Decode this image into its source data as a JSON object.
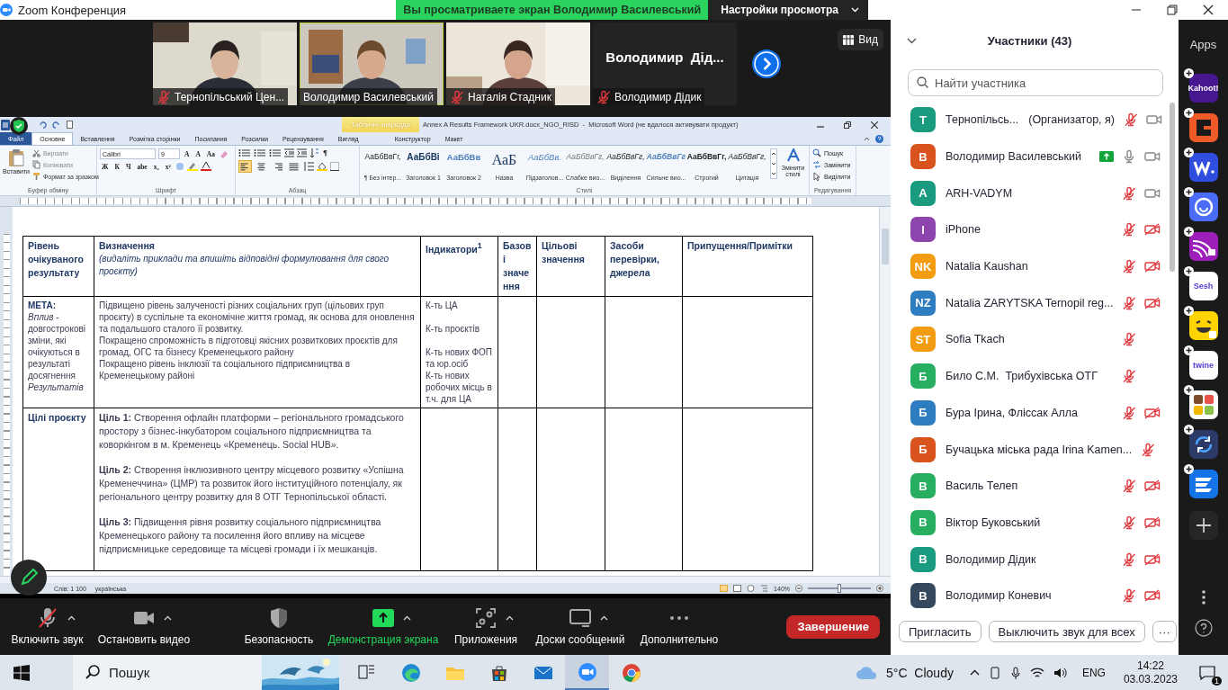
{
  "window": {
    "title": "Zoom Конференция"
  },
  "share_banner": {
    "text": "Вы просматриваете экран Володимир Василевський",
    "settings": "Настройки просмотра"
  },
  "videos": [
    {
      "kind": "picture",
      "name": "Тернопільський Цен...",
      "muted": true,
      "active": false
    },
    {
      "kind": "picture",
      "name": "Володимир Василевський",
      "muted": false,
      "active": true
    },
    {
      "kind": "picture",
      "name": "Наталія Стадник",
      "muted": true,
      "active": false
    },
    {
      "kind": "name",
      "display": "Володимир  Дід...",
      "name": "Володимир Дідик",
      "muted": true,
      "active": false
    }
  ],
  "view_button": "Вид",
  "word": {
    "title": "Annex A Results Framework UKR.docx_NGO_RISD  -  Microsoft Word (не вдалося активувати продукт)",
    "context_label": "Табличні знаряддя",
    "tabs": [
      {
        "label": "Файл",
        "kind": "file",
        "selected": false
      },
      {
        "label": "Основне",
        "kind": "tab",
        "selected": true
      },
      {
        "label": "Вставлення",
        "kind": "tab",
        "selected": false
      },
      {
        "label": "Розмітка сторінки",
        "kind": "tab",
        "selected": false
      },
      {
        "label": "Посилання",
        "kind": "tab",
        "selected": false
      },
      {
        "label": "Розсилки",
        "kind": "tab",
        "selected": false
      },
      {
        "label": "Рецензування",
        "kind": "tab",
        "selected": false
      },
      {
        "label": "Вигляд",
        "kind": "tab",
        "selected": false
      },
      {
        "label": "Конструктор",
        "kind": "context",
        "selected": false
      },
      {
        "label": "Макет",
        "kind": "context",
        "selected": false
      }
    ],
    "clipboard": {
      "paste": "Вставити",
      "items": [
        "Вирізати",
        "Копіювати",
        "Формат за зразком"
      ],
      "label": "Буфер обміну"
    },
    "font": {
      "name": "Calibri",
      "size": "9",
      "size_buttons": [
        "A",
        "A",
        "Aa"
      ],
      "buttons": [
        "Ж",
        "К",
        "Ч",
        "abe",
        "x₂",
        "x²"
      ],
      "label": "Шрифт"
    },
    "paragraph": {
      "marks_button": "¶",
      "alignments": [
        {
          "kind": "left",
          "selected": true
        },
        {
          "kind": "center",
          "selected": false
        },
        {
          "kind": "right",
          "selected": false
        },
        {
          "kind": "justify",
          "selected": false
        }
      ],
      "label": "Абзац"
    },
    "styles": {
      "items": [
        {
          "preview": "АаБбВвГг,",
          "name": "¶ Без інтер...",
          "kind": "normal"
        },
        {
          "preview": "АаБбВі",
          "name": "Заголовок 1",
          "kind": "heading"
        },
        {
          "preview": "АаБбВв",
          "name": "Заголовок 2",
          "kind": "heading2"
        },
        {
          "preview": "АаБ",
          "name": "Назва",
          "kind": "title"
        },
        {
          "preview": "АаБбВв.",
          "name": "Підзаголов...",
          "kind": "subtitle"
        },
        {
          "preview": "АаБбВвГг,",
          "name": "Слабке вио...",
          "kind": "subtle"
        },
        {
          "preview": "АаБбВвГг,",
          "name": "Виділення",
          "kind": "emphasis"
        },
        {
          "preview": "АаБбВвГг",
          "name": "Сильне вио...",
          "kind": "intense"
        },
        {
          "preview": "АаБбВвГг,",
          "name": "Строгий",
          "kind": "strong"
        },
        {
          "preview": "АаБбВвГг,",
          "name": "Цитація",
          "kind": "quote"
        }
      ],
      "change": "Змінити стилі",
      "label": "Стилі"
    },
    "editing": {
      "items": [
        "Пошук",
        "Замінити",
        "Виділити"
      ],
      "label": "Редагування"
    },
    "table": {
      "columns": [
        {
          "title": "Рівень очікуваного результату"
        },
        {
          "title": "Визначення",
          "note": "(видаліть приклади та впишіть відповідні формулювання для свого проєкту)"
        },
        {
          "title": "Індикатори$^{1}$"
        },
        {
          "title": "Базові значення"
        },
        {
          "title": "Цільові значення"
        },
        {
          "title": "Засоби перевірки, джерела"
        },
        {
          "title": "Припущення/Примітки"
        }
      ],
      "rows": [
        {
          "cells": [
            [
              {
                "text": "МЕТА:",
                "kind": "label"
              },
              {
                "text": "*Вплив* - довгострокові зміни, які очікуються в результаті досягнення *Результатів*",
                "kind": "body"
              }
            ],
            [
              {
                "text": "Підвищено рівень залученості різних соціальних груп (цільових груп проєкту) в суспільне та економічне  життя громад, як основа для оновлення та подальшого сталого її розвитку.",
                "kind": "body"
              },
              {
                "text": "Покращено спроможність в підготовці якісних розвиткових проєктів для громад, ОГС та бізнесу Кременецького  району",
                "kind": "body"
              },
              {
                "text": "Покращено рівень інклюзії та соціального підприємництва в Кременецькому  районі",
                "kind": "body"
              }
            ],
            [
              {
                "text": "К-ть ЦА",
                "kind": "item"
              },
              {
                "text": "К-ть проєктів",
                "kind": "item"
              },
              {
                "text": "К-ть нових ФОП та юр.осіб",
                "kind": "body"
              },
              {
                "text": "К-ть нових робочих місць в т.ч. для ЦА",
                "kind": "body"
              }
            ]
          ]
        },
        {
          "cells": [
            [
              {
                "text": "Цілі проєкту",
                "kind": "label"
              }
            ],
            [
              {
                "text": "**Ціль 1:** Створення  офлайн платформи – регіонального громадського простору з бізнес-інкубатором  соціального підприємництва  та коворкінгом  в м. Кременець «Кременець. Social HUB».",
                "kind": "item"
              },
              {
                "text": "**Ціль 2:** Створення  інклюзивного центру місцевого розвитку «Успішна Кременеччина» (ЦМР) та розвиток його інституційного потенціалу, як регіонального центру розвитку для 8 ОТГ Тернопільської області.",
                "kind": "item"
              },
              {
                "text": "**Ціль 3:** Підвищення  рівня розвитку соціального підприємництва Кременецького  району та посилення його впливу на місцеве підприємницьке  середовище  та місцеві громади і їх мешканців.",
                "kind": "item"
              }
            ]
          ]
        }
      ]
    },
    "status_bar": {
      "words": "Слів: 1 100",
      "language": "українська",
      "zoom": "140%",
      "level": 0.5
    }
  },
  "toolbar": {
    "items": [
      {
        "label": "Включить звук",
        "kind": "mic-off",
        "caret": true,
        "active": false
      },
      {
        "label": "Остановить видео",
        "kind": "video",
        "caret": true,
        "active": false
      },
      {
        "label": "Безопасность",
        "kind": "security",
        "caret": false,
        "active": false
      },
      {
        "label": "Демонстрация экрана",
        "kind": "share",
        "caret": true,
        "active": true
      },
      {
        "label": "Приложения",
        "kind": "apps",
        "caret": true,
        "active": false
      },
      {
        "label": "Доски сообщений",
        "kind": "whiteboard",
        "caret": true,
        "active": false
      },
      {
        "label": "Дополнительно",
        "kind": "more",
        "caret": false,
        "active": false
      }
    ],
    "end_button": "Завершение"
  },
  "participants": {
    "title": "Участники (43)",
    "search": {
      "placeholder": "Найти участника"
    },
    "items": [
      {
        "initials": "Т",
        "color": "#1a9b80",
        "name": "Тернопільсь...",
        "role": "(Организатор, я)",
        "sharing": false,
        "muted": true,
        "kind": "camera-on"
      },
      {
        "initials": "В",
        "color": "#d9531e",
        "name": "Володимир Василевський",
        "sharing": true,
        "muted": false,
        "kind": "camera-on"
      },
      {
        "initials": "A",
        "color": "#1a9b80",
        "name": "ARH-VADYM",
        "sharing": false,
        "muted": true,
        "kind": "camera-on"
      },
      {
        "initials": "I",
        "color": "#8e44ad",
        "name": "iPhone",
        "sharing": false,
        "muted": true,
        "kind": "camera-off"
      },
      {
        "initials": "NK",
        "color": "#f39c12",
        "name": "Natalia Kaushan",
        "sharing": false,
        "muted": true,
        "kind": "camera-off"
      },
      {
        "initials": "NZ",
        "color": "#2e7dc0",
        "name": "Natalia ZARYTSKA Ternopil reg...",
        "sharing": false,
        "muted": true,
        "kind": "camera-off"
      },
      {
        "initials": "ST",
        "color": "#f39c12",
        "name": "Sofia Tkach",
        "sharing": false,
        "muted": true,
        "kind": "audio-only"
      },
      {
        "initials": "Б",
        "color": "#27ae60",
        "name": "Било С.М.  Трибухівська ОТГ",
        "sharing": false,
        "muted": true,
        "kind": "audio-only"
      },
      {
        "initials": "Б",
        "color": "#2e7dc0",
        "name": "Бура Ірина, Фліссак Алла",
        "sharing": false,
        "muted": true,
        "kind": "camera-off"
      },
      {
        "initials": "Б",
        "color": "#d9531e",
        "name": "Бучацька міська рада Irina Kamen...",
        "sharing": false,
        "muted": true,
        "kind": "audio-only"
      },
      {
        "initials": "В",
        "color": "#27ae60",
        "name": "Василь Телеп",
        "sharing": false,
        "muted": true,
        "kind": "camera-off"
      },
      {
        "initials": "В",
        "color": "#27ae60",
        "name": "Віктор Буковський",
        "sharing": false,
        "muted": true,
        "kind": "camera-off"
      },
      {
        "initials": "В",
        "color": "#1a9b80",
        "name": "Володимир Дідик",
        "sharing": false,
        "muted": true,
        "kind": "camera-off"
      },
      {
        "initials": "В",
        "color": "#34495e",
        "name": "Володимир Коневич",
        "sharing": false,
        "muted": true,
        "kind": "camera-off"
      }
    ],
    "buttons": [
      "Пригласить",
      "Выключить звук для всех"
    ],
    "more": "···"
  },
  "apps": {
    "title": "Apps",
    "items": [
      {
        "kind": "label",
        "label": "Kahoot!",
        "color": "#46178f"
      },
      {
        "kind": "bracket",
        "color": "#f05a28"
      },
      {
        "kind": "w",
        "color": "#2f4de0"
      },
      {
        "kind": "face",
        "color": "#4a6cf7"
      },
      {
        "kind": "rays",
        "color": "#9b1fb8"
      },
      {
        "kind": "label",
        "label": "Sesh",
        "color": "#ffffff"
      },
      {
        "kind": "emoji",
        "color": "#ffd400"
      },
      {
        "kind": "label",
        "label": "twine",
        "color": "#ffffff"
      },
      {
        "kind": "blocks",
        "color": "#ffffff"
      },
      {
        "kind": "sync",
        "color": "#2b3a67"
      },
      {
        "kind": "stack",
        "color": "#1473e6"
      }
    ]
  },
  "taskbar": {
    "search": {
      "placeholder": "Пошук"
    },
    "pinned": [
      {
        "kind": "taskview",
        "selected": false
      },
      {
        "kind": "edge",
        "selected": false
      },
      {
        "kind": "folder",
        "selected": false
      },
      {
        "kind": "store",
        "selected": false
      },
      {
        "kind": "mail",
        "selected": false
      },
      {
        "kind": "zoom",
        "selected": true
      },
      {
        "kind": "chrome",
        "selected": false
      }
    ],
    "weather": "5°C  Cloudy",
    "language": "ENG",
    "time": "14:22",
    "date": "03.03.2023",
    "notifications": "1"
  }
}
